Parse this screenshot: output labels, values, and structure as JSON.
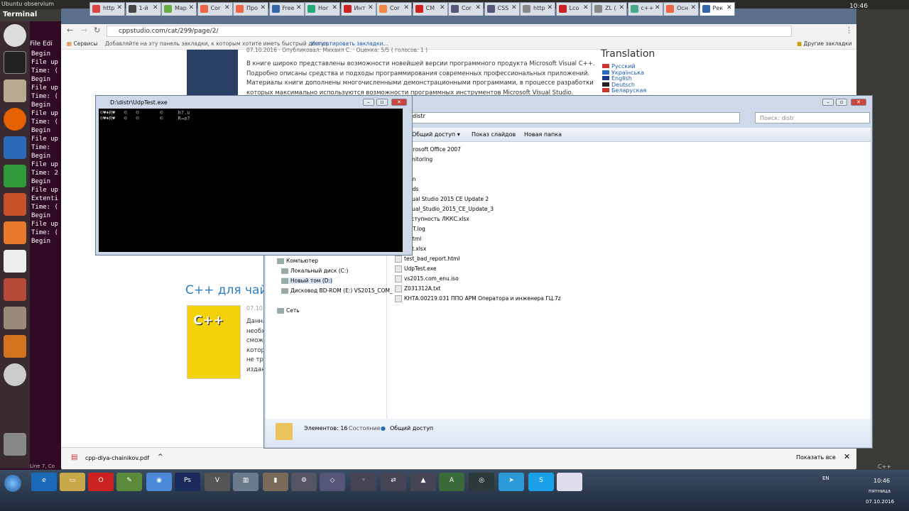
{
  "ubuntu": {
    "title": "Ubuntu observium",
    "clock": "10:46"
  },
  "terminal": {
    "title": "Terminal",
    "menu": [
      "File",
      "Edi"
    ],
    "lines": [
      "Begin",
      "File up",
      "Time: (",
      "Begin",
      "File up",
      "Time: (",
      "Begin",
      "File up",
      "Time: (",
      "Begin",
      "File up",
      "Time:",
      "Begin",
      "File up",
      "Time: 2",
      "Begin",
      "File up",
      "Extenti",
      "Time: (",
      "Begin",
      "File up",
      "Time: (",
      "Begin"
    ],
    "status": "Line 7, Co"
  },
  "chrome": {
    "tabs": [
      "http",
      "1-й",
      "Мар",
      "Cor",
      "Про",
      "Free",
      "Hor",
      "Инт",
      "Cor",
      "CM",
      "Cor",
      "CSS",
      "http",
      "Lco",
      "ZL (",
      "c++",
      "Осн",
      "Рек"
    ],
    "url": "cppstudio.com/cat/299/page/2/",
    "bookmarks": {
      "apps": "Сервисы",
      "hint": "Добавляйте на эту панель закладки, к которым хотите иметь быстрый доступ.",
      "import": "Импортировать закладки...",
      "other": "Другие закладки"
    },
    "page": {
      "book1_meta": "07.10.2016 · Опубликовал: Михаил С. · Оценка: 5/5 ( голосов: 1 )",
      "book1_text": [
        "В книге широко представлены возможности новейшей версии программного продукта Microsoft Visual C++.",
        "Подробно описаны средства и подходы программирования современных профессиональных приложений.",
        "Материалы книги дополнены многочисленными демонстрационными программами, в процессе разработки",
        "которых максимально используются возможности программных инструментов Microsoft Visual Studio."
      ],
      "translation_title": "Translation",
      "languages": [
        "Русский",
        "Українська",
        "English",
        "Deutsch",
        "Беларуская"
      ],
      "book2_title": "C++ для чай",
      "book2_date": "07.10",
      "book2_text": [
        "Данна",
        "необх",
        "сможе",
        "котор",
        "не тр",
        "издан"
      ]
    },
    "download": {
      "file": "cpp-dlya-chainikov.pdf",
      "show_all": "Показать все"
    }
  },
  "console": {
    "title": "D:\\distr\\UdpTest.exe",
    "lines": [
      "©♥♦R♥   ©   ©       ©     h?.υ",
      "©♥♦R♥   ©   ©       ©     R→a?"
    ]
  },
  "explorer": {
    "path": "distr",
    "search_placeholder": "Поиск: distr",
    "toolbar": [
      "Общий доступ ▾",
      "Показ слайдов",
      "Новая папка"
    ],
    "files": [
      "Microsoft Office 2007",
      "Monitoring",
      "...c",
      "...on",
      "...ads",
      "Visual Studio 2015 CE Update 2",
      "Visual_Studio_2015_CE_Update_3",
      "Доступность ЛККС.xlsx",
      "...VT.log",
      "...html",
      "...st.xlsx",
      "test_bad_report.html",
      "UdpTest.exe",
      "vs2015.com_enu.iso",
      "Z031312A.txt",
      "КНТА.00219.031 ППО АРМ Оператора и инженера ГЦ.7z"
    ],
    "nav": [
      "Компьютер",
      "Локальный диск (C:)",
      "Новый том (D:)",
      "Дисковод BD-ROM (E:) VS2015_COM_",
      "Сеть"
    ],
    "status_count": "Элементов: 16",
    "status_state_label": "Состояние:",
    "status_state": "Общий доступ"
  },
  "taskbar": {
    "lang": "EN",
    "time": "10:46",
    "day": "пятница",
    "date": "07.10.2016",
    "cpp_label": "C++"
  }
}
